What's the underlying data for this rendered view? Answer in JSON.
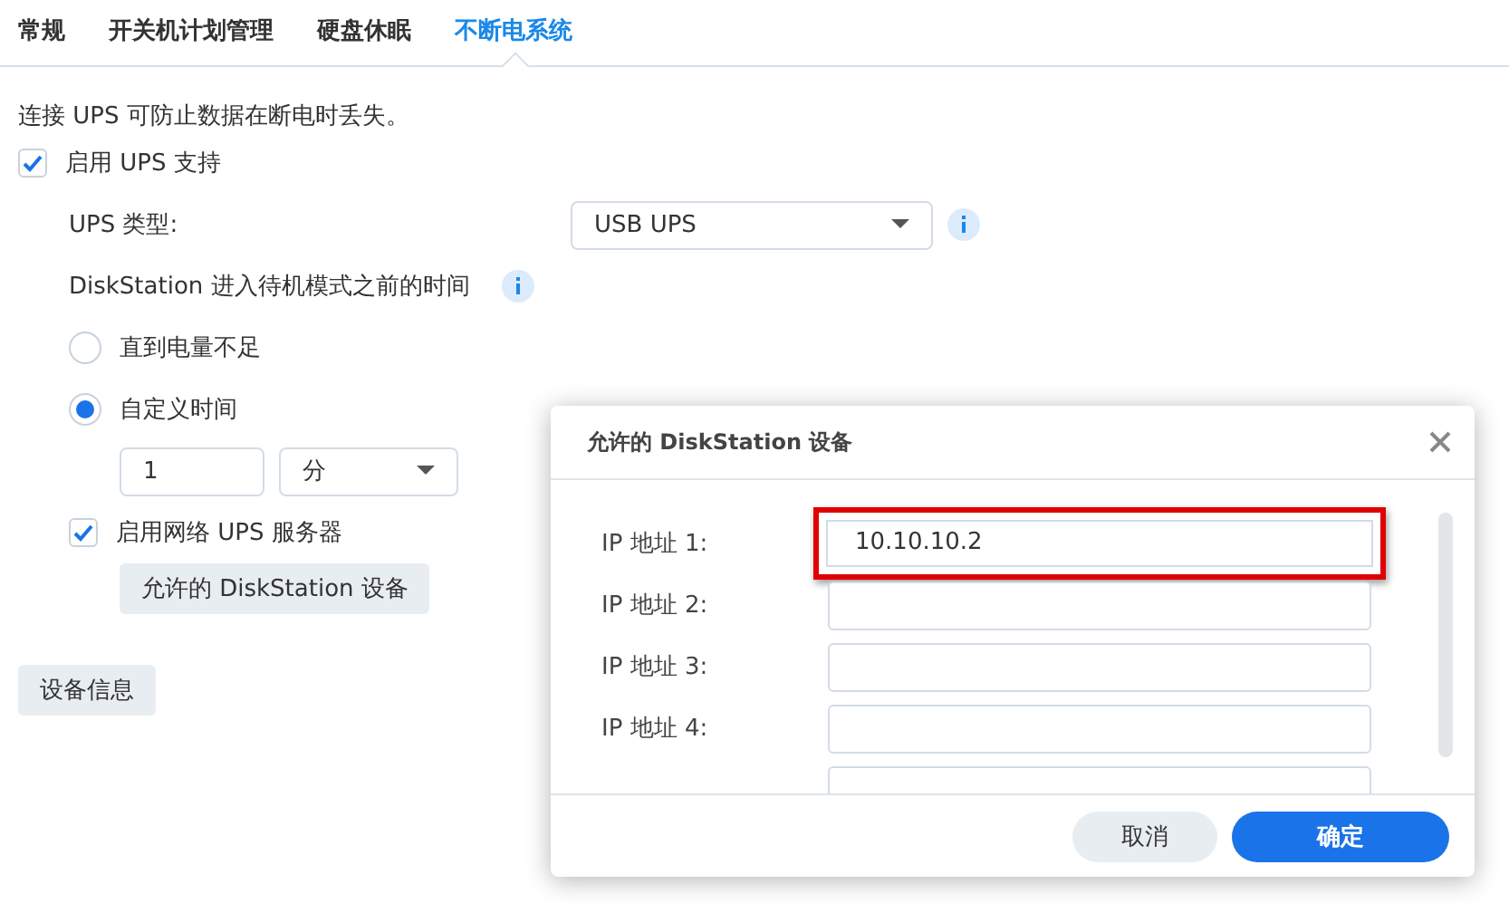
{
  "tabs": [
    {
      "label": "常规",
      "selected": false
    },
    {
      "label": "开关机计划管理",
      "selected": false
    },
    {
      "label": "硬盘休眠",
      "selected": false
    },
    {
      "label": "不断电系统",
      "selected": true
    }
  ],
  "description": "连接 UPS 可防止数据在断电时丢失。",
  "ups_support": {
    "label": "启用 UPS 支持",
    "checked": true
  },
  "ups_type": {
    "label": "UPS 类型:",
    "value": "USB UPS"
  },
  "standby_time": {
    "label": "DiskStation 进入待机模式之前的时间"
  },
  "standby_options": [
    {
      "label": "直到电量不足",
      "selected": false
    },
    {
      "label": "自定义时间",
      "selected": true
    }
  ],
  "custom_time": {
    "value": "1",
    "unit": "分"
  },
  "network_ups_server": {
    "label": "启用网络 UPS 服务器",
    "checked": true
  },
  "allowed_devices_button": "允许的 DiskStation 设备",
  "device_info_button": "设备信息",
  "dialog": {
    "title": "允许的 DiskStation 设备",
    "fields": [
      {
        "label": "IP 地址 1:",
        "value": "10.10.10.2",
        "highlighted": true
      },
      {
        "label": "IP 地址 2:",
        "highlighted": false
      },
      {
        "label": "IP 地址 3:",
        "highlighted": false
      },
      {
        "label": "IP 地址 4:",
        "highlighted": false
      },
      {
        "highlighted": false
      }
    ],
    "buttons": [
      {
        "label": "取消",
        "kind": "secondary"
      },
      {
        "label": "确定",
        "kind": "primary"
      }
    ]
  }
}
